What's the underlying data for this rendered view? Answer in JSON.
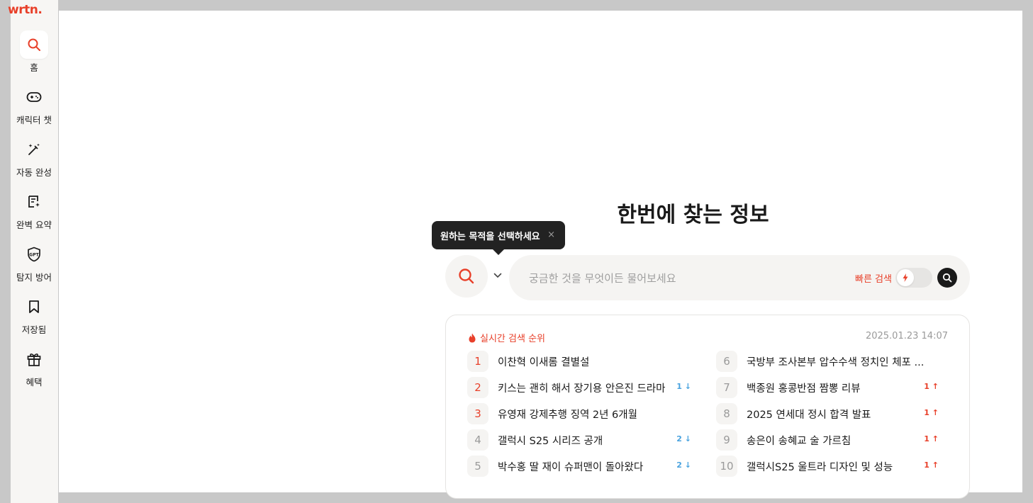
{
  "app": {
    "logo": "wrtn."
  },
  "sidebar": {
    "items": [
      {
        "label": "홈",
        "icon": "search-icon",
        "active": true
      },
      {
        "label": "캐릭터 챗",
        "icon": "gamepad-icon"
      },
      {
        "label": "자동 완성",
        "icon": "magic-wand-icon"
      },
      {
        "label": "완벽 요약",
        "icon": "summary-doc-icon"
      },
      {
        "label": "탐지 방어",
        "icon": "gpt-shield-icon"
      },
      {
        "label": "저장됨",
        "icon": "bookmark-icon"
      },
      {
        "label": "혜택",
        "icon": "gift-icon"
      }
    ]
  },
  "main": {
    "heading": "한번에 찾는 정보",
    "tooltip": {
      "text": "원하는 목적을 선택하세요",
      "close": "×"
    },
    "search": {
      "placeholder": "궁금한 것을 무엇이든 물어보세요",
      "fast_search_label": "빠른 검색"
    },
    "trending": {
      "title": "실시간 검색 순위",
      "timestamp": "2025.01.23 14:07",
      "items": [
        {
          "rank": "1",
          "keyword": "이찬혁 이새롬 결별설",
          "change": ""
        },
        {
          "rank": "2",
          "keyword": "키스는 괜히 해서 장기용 안은진 드라마",
          "change": "1 ↓"
        },
        {
          "rank": "3",
          "keyword": "유영재 강제추행 징역 2년 6개월",
          "change": ""
        },
        {
          "rank": "4",
          "keyword": "갤럭시 S25 시리즈 공개",
          "change": "2 ↓"
        },
        {
          "rank": "5",
          "keyword": "박수홍 딸 재이 슈퍼맨이 돌아왔다",
          "change": "2 ↓"
        },
        {
          "rank": "6",
          "keyword": "국방부 조사본부 압수수색 정치인 체포 ...",
          "change": ""
        },
        {
          "rank": "7",
          "keyword": "백종원 홍콩반점 짬뽕 리뷰",
          "change": "1 ↑"
        },
        {
          "rank": "8",
          "keyword": "2025 연세대 정시 합격 발표",
          "change": "1 ↑"
        },
        {
          "rank": "9",
          "keyword": "송은이 송혜교 술 가르침",
          "change": "1 ↑"
        },
        {
          "rank": "10",
          "keyword": "갤럭시S25 울트라 디자인 및 성능",
          "change": "1 ↑"
        }
      ]
    }
  },
  "colors": {
    "accent": "#e8402a",
    "down": "#4aa3df",
    "sidebar_bg": "#f7f6f4"
  }
}
